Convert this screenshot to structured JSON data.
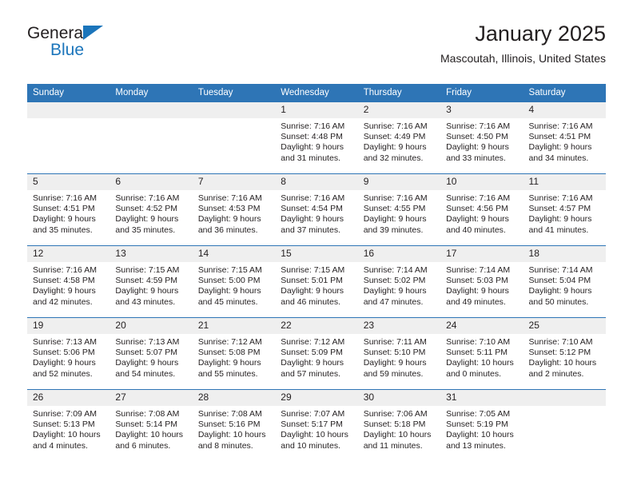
{
  "brand": {
    "name_part1": "General",
    "name_part2": "Blue",
    "accent_color": "#1b75bb"
  },
  "header": {
    "title": "January 2025",
    "subtitle": "Mascoutah, Illinois, United States"
  },
  "theme": {
    "header_blue": "#2e75b6",
    "daynum_gray": "#efefef",
    "text": "#231f20"
  },
  "calendar": {
    "weekday_headers": [
      "Sunday",
      "Monday",
      "Tuesday",
      "Wednesday",
      "Thursday",
      "Friday",
      "Saturday"
    ],
    "weeks": [
      [
        {
          "day": "",
          "lines": []
        },
        {
          "day": "",
          "lines": []
        },
        {
          "day": "",
          "lines": []
        },
        {
          "day": "1",
          "lines": [
            "Sunrise: 7:16 AM",
            "Sunset: 4:48 PM",
            "Daylight: 9 hours",
            "and 31 minutes."
          ]
        },
        {
          "day": "2",
          "lines": [
            "Sunrise: 7:16 AM",
            "Sunset: 4:49 PM",
            "Daylight: 9 hours",
            "and 32 minutes."
          ]
        },
        {
          "day": "3",
          "lines": [
            "Sunrise: 7:16 AM",
            "Sunset: 4:50 PM",
            "Daylight: 9 hours",
            "and 33 minutes."
          ]
        },
        {
          "day": "4",
          "lines": [
            "Sunrise: 7:16 AM",
            "Sunset: 4:51 PM",
            "Daylight: 9 hours",
            "and 34 minutes."
          ]
        }
      ],
      [
        {
          "day": "5",
          "lines": [
            "Sunrise: 7:16 AM",
            "Sunset: 4:51 PM",
            "Daylight: 9 hours",
            "and 35 minutes."
          ]
        },
        {
          "day": "6",
          "lines": [
            "Sunrise: 7:16 AM",
            "Sunset: 4:52 PM",
            "Daylight: 9 hours",
            "and 35 minutes."
          ]
        },
        {
          "day": "7",
          "lines": [
            "Sunrise: 7:16 AM",
            "Sunset: 4:53 PM",
            "Daylight: 9 hours",
            "and 36 minutes."
          ]
        },
        {
          "day": "8",
          "lines": [
            "Sunrise: 7:16 AM",
            "Sunset: 4:54 PM",
            "Daylight: 9 hours",
            "and 37 minutes."
          ]
        },
        {
          "day": "9",
          "lines": [
            "Sunrise: 7:16 AM",
            "Sunset: 4:55 PM",
            "Daylight: 9 hours",
            "and 39 minutes."
          ]
        },
        {
          "day": "10",
          "lines": [
            "Sunrise: 7:16 AM",
            "Sunset: 4:56 PM",
            "Daylight: 9 hours",
            "and 40 minutes."
          ]
        },
        {
          "day": "11",
          "lines": [
            "Sunrise: 7:16 AM",
            "Sunset: 4:57 PM",
            "Daylight: 9 hours",
            "and 41 minutes."
          ]
        }
      ],
      [
        {
          "day": "12",
          "lines": [
            "Sunrise: 7:16 AM",
            "Sunset: 4:58 PM",
            "Daylight: 9 hours",
            "and 42 minutes."
          ]
        },
        {
          "day": "13",
          "lines": [
            "Sunrise: 7:15 AM",
            "Sunset: 4:59 PM",
            "Daylight: 9 hours",
            "and 43 minutes."
          ]
        },
        {
          "day": "14",
          "lines": [
            "Sunrise: 7:15 AM",
            "Sunset: 5:00 PM",
            "Daylight: 9 hours",
            "and 45 minutes."
          ]
        },
        {
          "day": "15",
          "lines": [
            "Sunrise: 7:15 AM",
            "Sunset: 5:01 PM",
            "Daylight: 9 hours",
            "and 46 minutes."
          ]
        },
        {
          "day": "16",
          "lines": [
            "Sunrise: 7:14 AM",
            "Sunset: 5:02 PM",
            "Daylight: 9 hours",
            "and 47 minutes."
          ]
        },
        {
          "day": "17",
          "lines": [
            "Sunrise: 7:14 AM",
            "Sunset: 5:03 PM",
            "Daylight: 9 hours",
            "and 49 minutes."
          ]
        },
        {
          "day": "18",
          "lines": [
            "Sunrise: 7:14 AM",
            "Sunset: 5:04 PM",
            "Daylight: 9 hours",
            "and 50 minutes."
          ]
        }
      ],
      [
        {
          "day": "19",
          "lines": [
            "Sunrise: 7:13 AM",
            "Sunset: 5:06 PM",
            "Daylight: 9 hours",
            "and 52 minutes."
          ]
        },
        {
          "day": "20",
          "lines": [
            "Sunrise: 7:13 AM",
            "Sunset: 5:07 PM",
            "Daylight: 9 hours",
            "and 54 minutes."
          ]
        },
        {
          "day": "21",
          "lines": [
            "Sunrise: 7:12 AM",
            "Sunset: 5:08 PM",
            "Daylight: 9 hours",
            "and 55 minutes."
          ]
        },
        {
          "day": "22",
          "lines": [
            "Sunrise: 7:12 AM",
            "Sunset: 5:09 PM",
            "Daylight: 9 hours",
            "and 57 minutes."
          ]
        },
        {
          "day": "23",
          "lines": [
            "Sunrise: 7:11 AM",
            "Sunset: 5:10 PM",
            "Daylight: 9 hours",
            "and 59 minutes."
          ]
        },
        {
          "day": "24",
          "lines": [
            "Sunrise: 7:10 AM",
            "Sunset: 5:11 PM",
            "Daylight: 10 hours",
            "and 0 minutes."
          ]
        },
        {
          "day": "25",
          "lines": [
            "Sunrise: 7:10 AM",
            "Sunset: 5:12 PM",
            "Daylight: 10 hours",
            "and 2 minutes."
          ]
        }
      ],
      [
        {
          "day": "26",
          "lines": [
            "Sunrise: 7:09 AM",
            "Sunset: 5:13 PM",
            "Daylight: 10 hours",
            "and 4 minutes."
          ]
        },
        {
          "day": "27",
          "lines": [
            "Sunrise: 7:08 AM",
            "Sunset: 5:14 PM",
            "Daylight: 10 hours",
            "and 6 minutes."
          ]
        },
        {
          "day": "28",
          "lines": [
            "Sunrise: 7:08 AM",
            "Sunset: 5:16 PM",
            "Daylight: 10 hours",
            "and 8 minutes."
          ]
        },
        {
          "day": "29",
          "lines": [
            "Sunrise: 7:07 AM",
            "Sunset: 5:17 PM",
            "Daylight: 10 hours",
            "and 10 minutes."
          ]
        },
        {
          "day": "30",
          "lines": [
            "Sunrise: 7:06 AM",
            "Sunset: 5:18 PM",
            "Daylight: 10 hours",
            "and 11 minutes."
          ]
        },
        {
          "day": "31",
          "lines": [
            "Sunrise: 7:05 AM",
            "Sunset: 5:19 PM",
            "Daylight: 10 hours",
            "and 13 minutes."
          ]
        },
        {
          "day": "",
          "lines": []
        }
      ]
    ]
  }
}
